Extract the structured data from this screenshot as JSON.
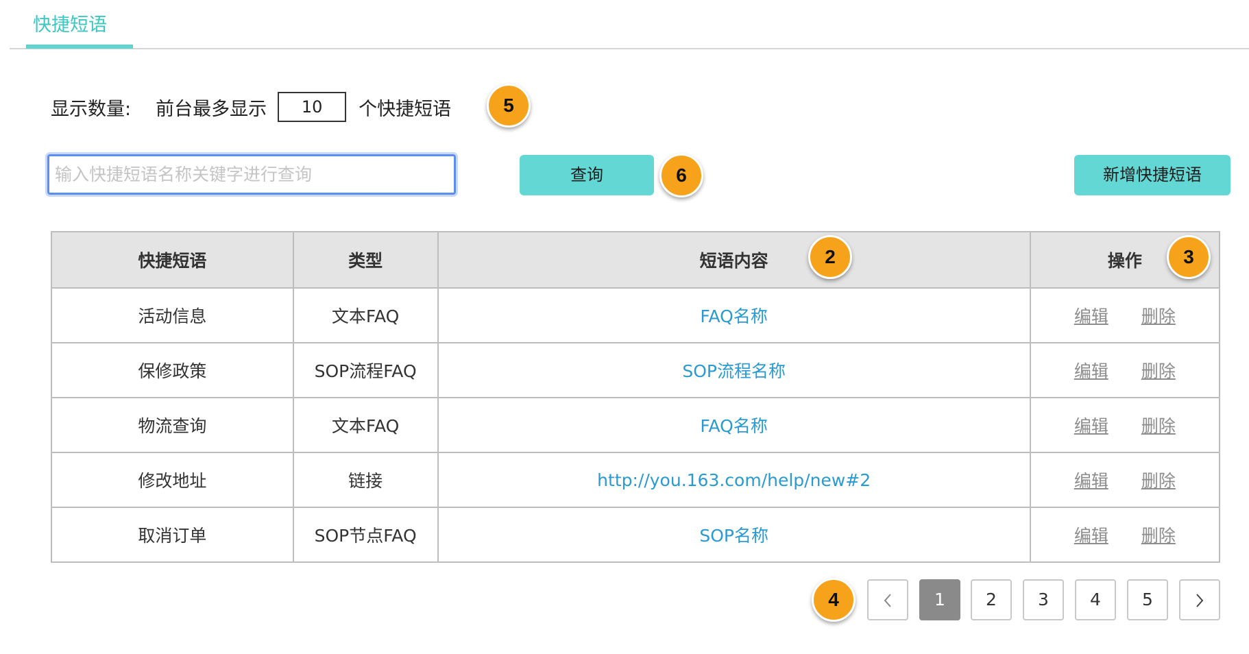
{
  "tab": {
    "label": "快捷短语"
  },
  "display_limit": {
    "label": "显示数量:",
    "prefix": "前台最多显示",
    "value": "10",
    "suffix": "个快捷短语"
  },
  "search": {
    "placeholder": "输入快捷短语名称关键字进行查询",
    "value": ""
  },
  "buttons": {
    "query_label": "查询",
    "add_label": "新增快捷短语"
  },
  "table": {
    "headers": [
      "快捷短语",
      "类型",
      "短语内容",
      "操作"
    ],
    "rows": [
      {
        "phrase": "活动信息",
        "type": "文本FAQ",
        "content": "FAQ名称"
      },
      {
        "phrase": "保修政策",
        "type": "SOP流程FAQ",
        "content": "SOP流程名称"
      },
      {
        "phrase": "物流查询",
        "type": "文本FAQ",
        "content": "FAQ名称"
      },
      {
        "phrase": "修改地址",
        "type": "链接",
        "content": "http://you.163.com/help/new#2"
      },
      {
        "phrase": "取消订单",
        "type": "SOP节点FAQ",
        "content": "SOP名称"
      }
    ],
    "edit_label": "编辑",
    "delete_label": "删除"
  },
  "pagination": {
    "pages": [
      "1",
      "2",
      "3",
      "4",
      "5"
    ],
    "current_page": "1",
    "prev_icon": "chevron-left-icon",
    "next_icon": "chevron-right-icon"
  },
  "annotations": [
    "5",
    "6",
    "2",
    "3",
    "4"
  ],
  "colors": {
    "accent": "#5fd4cf",
    "link": "#2a9ad3",
    "badge": "#f7a21b",
    "header_bg": "#e4e4e4",
    "active_page": "#8a8a8a"
  }
}
